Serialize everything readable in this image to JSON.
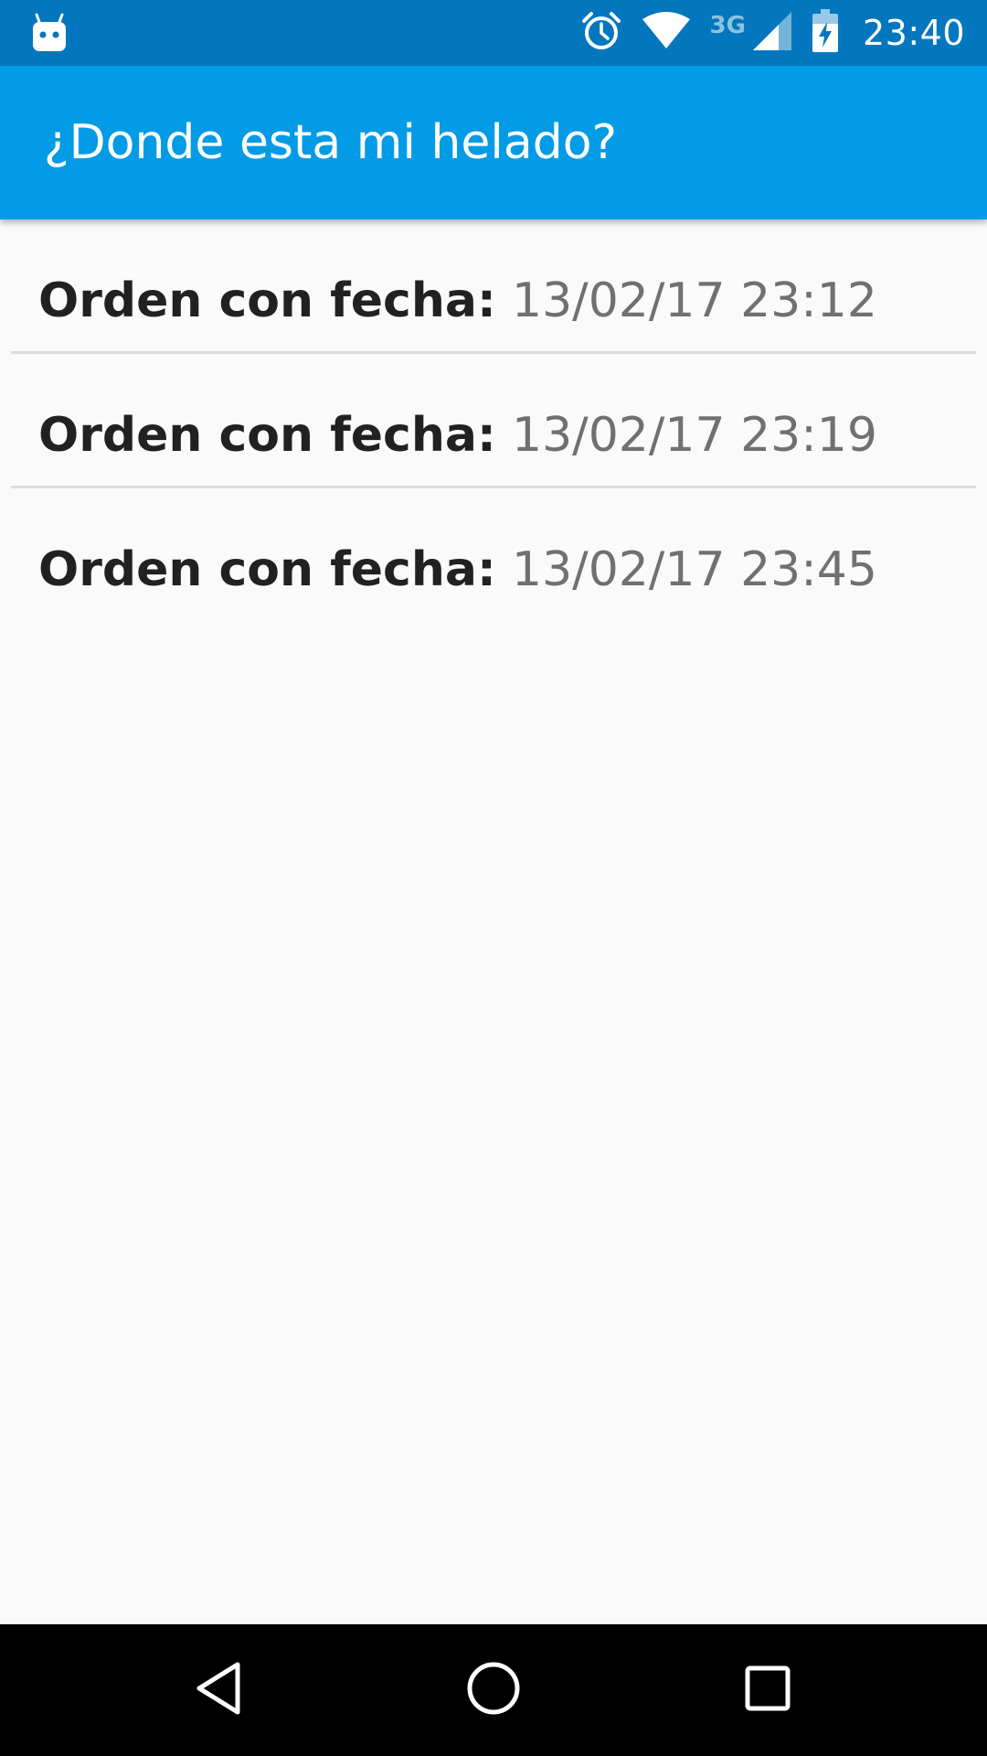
{
  "status_bar": {
    "app_icon": "android-notification-icon",
    "network_type": "3G",
    "time": "23:40",
    "icons": [
      "alarm-icon",
      "wifi-icon",
      "cell-signal-icon",
      "battery-charging-icon"
    ],
    "background_color": "#0277bd"
  },
  "app_bar": {
    "title": "¿Donde esta mi helado?",
    "background_color": "#039be5"
  },
  "orders": [
    {
      "label": "Orden con fecha:",
      "date": "13/02/17 23:12"
    },
    {
      "label": "Orden con fecha:",
      "date": "13/02/17 23:19"
    },
    {
      "label": "Orden con fecha:",
      "date": "13/02/17 23:45"
    }
  ],
  "nav_bar": {
    "buttons": [
      "back-icon",
      "home-icon",
      "recents-icon"
    ]
  }
}
